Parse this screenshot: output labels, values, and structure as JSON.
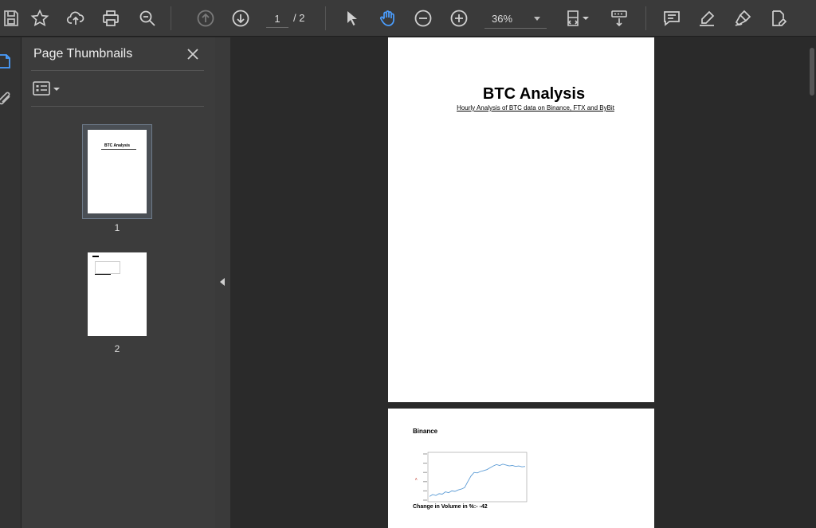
{
  "toolbar": {
    "page_current": "1",
    "page_total": "/ 2",
    "zoom": "36%"
  },
  "panel": {
    "title": "Page Thumbnails",
    "thumbnails": [
      {
        "number": "1"
      },
      {
        "number": "2"
      }
    ]
  },
  "document": {
    "page1": {
      "title": "BTC Analysis",
      "subtitle": "Hourly Analysis of BTC data on Binance, FTX and ByBit"
    },
    "page2": {
      "section_title": "Binance",
      "footer": "Change in Volume in %:- -42"
    }
  },
  "chart_data": {
    "type": "line",
    "title": "",
    "xlabel": "",
    "ylabel": "",
    "x": [
      0,
      1,
      2,
      3,
      4,
      5,
      6,
      7,
      8,
      9,
      10,
      11,
      12,
      13,
      14,
      15,
      16,
      17,
      18,
      19,
      20,
      21,
      22,
      23,
      24,
      25,
      26,
      27,
      28,
      29,
      30
    ],
    "values": [
      8,
      12,
      10,
      14,
      13,
      18,
      16,
      20,
      19,
      22,
      24,
      27,
      40,
      52,
      60,
      59,
      62,
      64,
      66,
      70,
      74,
      77,
      75,
      78,
      76,
      74,
      75,
      73,
      74,
      72,
      73
    ],
    "ylim": [
      0,
      100
    ],
    "color": "#5b9bd5"
  },
  "colors": {
    "accent": "#4a9eff",
    "toolbar_bg": "#3a3a3a",
    "panel_bg": "#3c3c3c",
    "canvas_bg": "#2a2a2a"
  }
}
